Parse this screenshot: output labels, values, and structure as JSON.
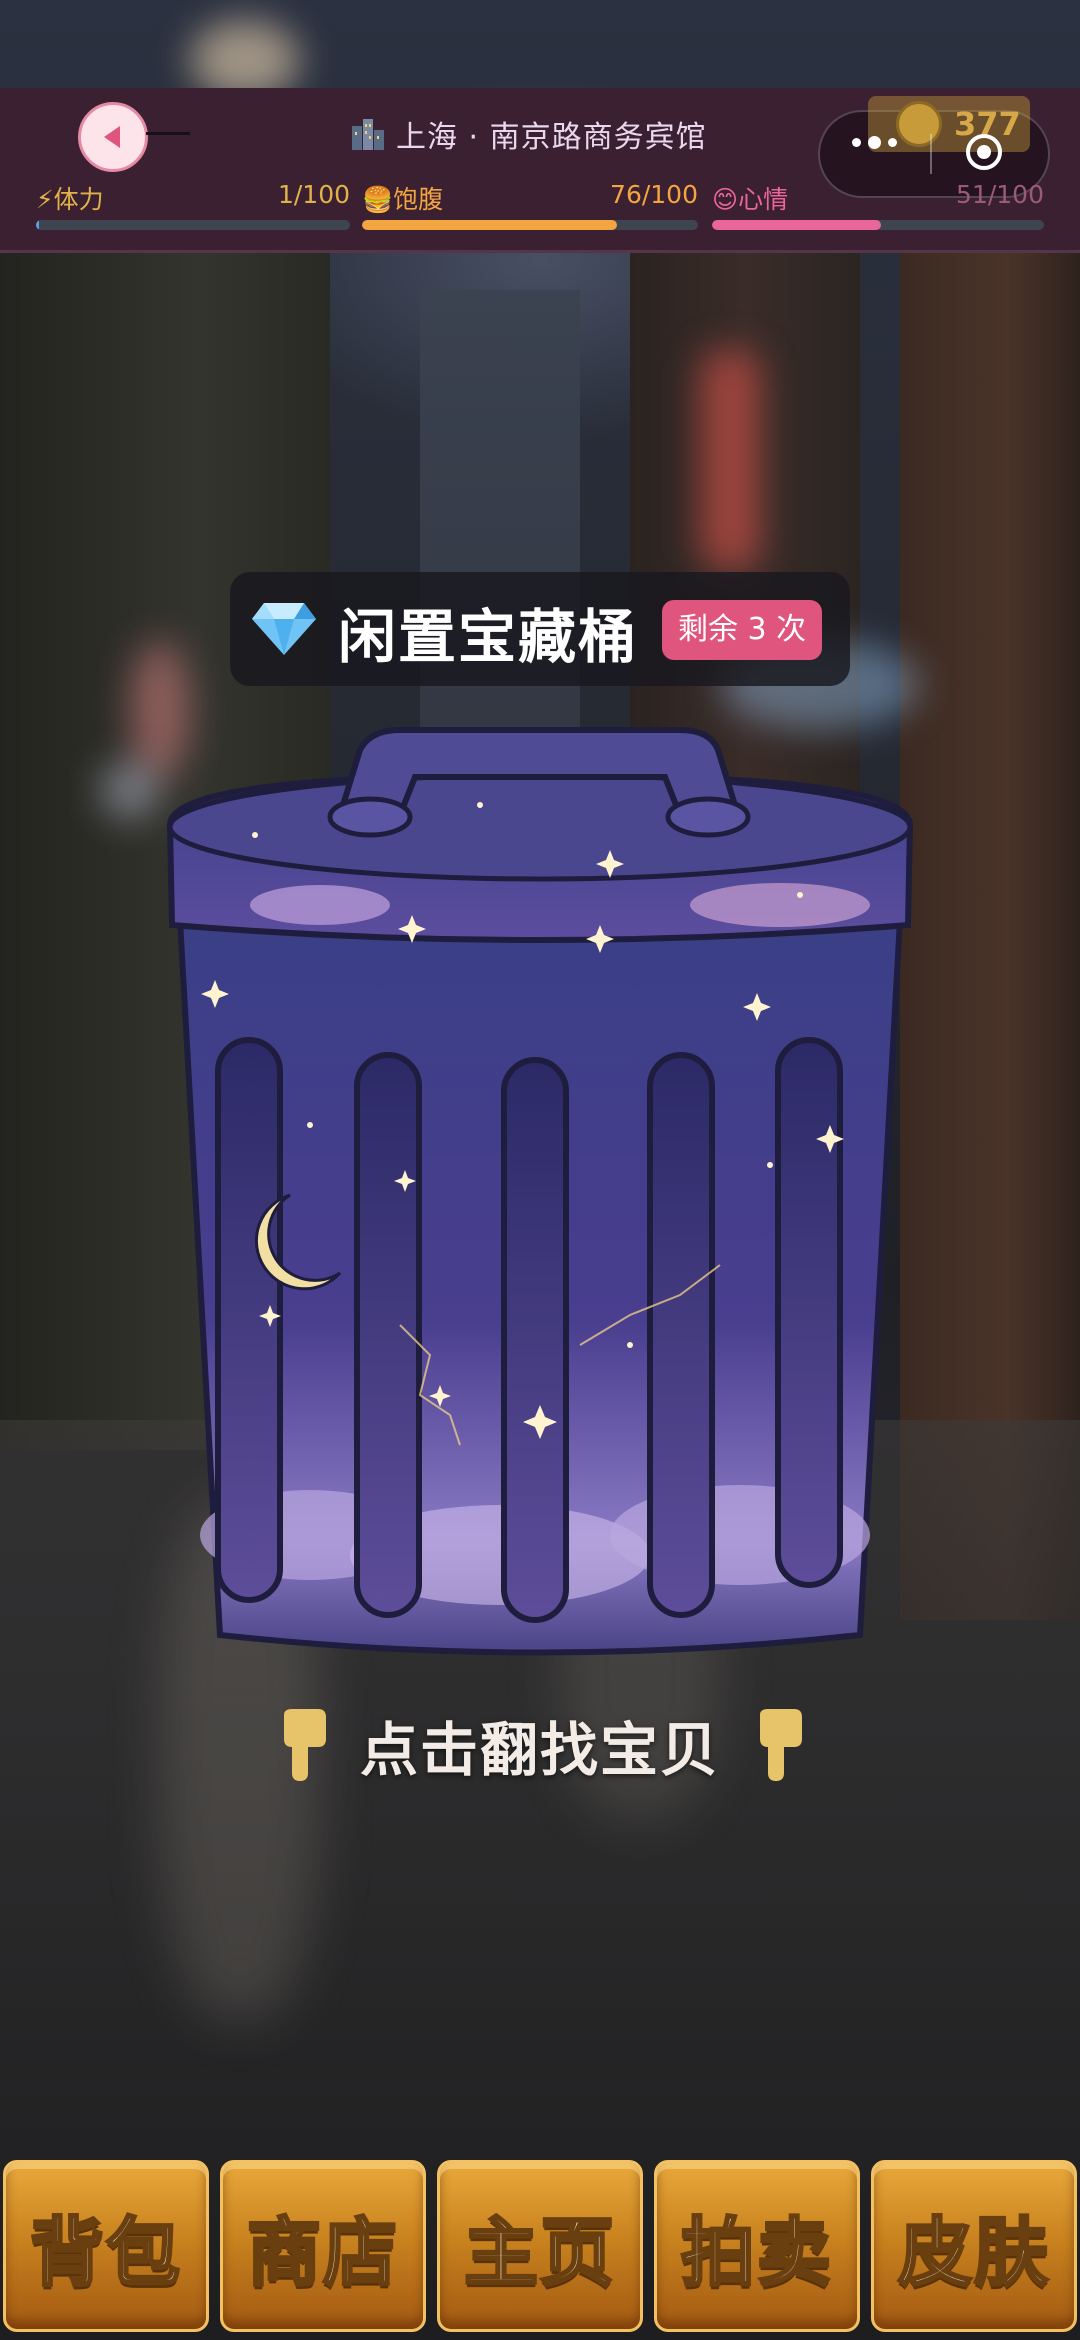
{
  "header": {
    "back_icon": "back-arrow-icon",
    "location_icon": "city-icon",
    "location": "上海 · 南京路商务宾馆",
    "coins": "377",
    "stats": [
      {
        "icon": "⚡",
        "label": "体力",
        "value": "1/100",
        "fraction": 0.01,
        "color": "#5aa0e6"
      },
      {
        "icon": "🍔",
        "label": "饱腹",
        "value": "76/100",
        "fraction": 0.76,
        "color": "#f2a540"
      },
      {
        "icon": "😊",
        "label": "心情",
        "value": "51/100",
        "fraction": 0.51,
        "color": "#e9659b"
      }
    ]
  },
  "main": {
    "title_icon": "diamond-icon",
    "title": "闲置宝藏桶",
    "remaining": "剩余 3 次",
    "object": "starry-trash-can",
    "hint": "点击翻找宝贝",
    "hint_icon": "pointing-down-hand-icon"
  },
  "bottom_nav": [
    {
      "label": "背包"
    },
    {
      "label": "商店"
    },
    {
      "label": "主页"
    },
    {
      "label": "拍卖"
    },
    {
      "label": "皮肤"
    }
  ],
  "colors": {
    "header_bg": "#3b2031",
    "badge": "#e0557d",
    "nav_gold": "#c9831f"
  }
}
